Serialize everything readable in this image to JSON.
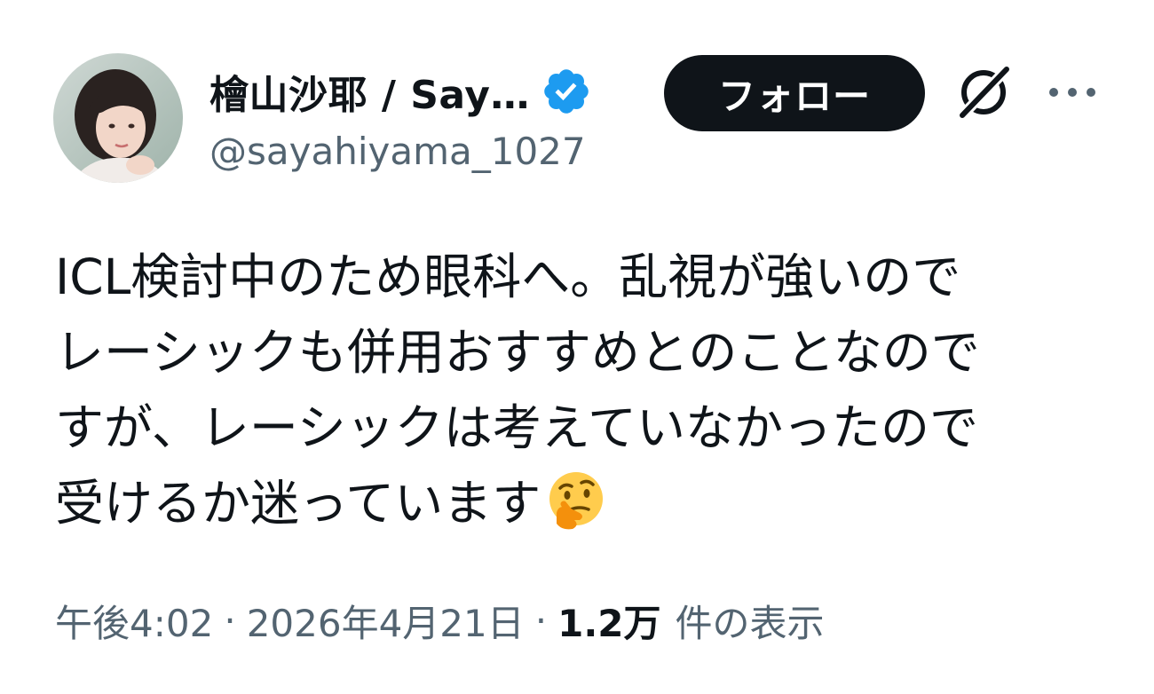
{
  "author": {
    "display_name": "檜山沙耶 / Say…",
    "handle": "@sayahiyama_1027",
    "verified": true
  },
  "header": {
    "follow_label": "フォロー",
    "grok_icon": "grok-icon",
    "more_icon": "more-horizontal-icon"
  },
  "tweet": {
    "lines": [
      "ICL検討中のため眼科へ。乱視が強いので",
      "レーシックも併用おすすめとのことなので",
      "すが、レーシックは考えていなかったので",
      "受けるか迷っています"
    ],
    "trailing_emoji": "thinking-face-emoji"
  },
  "meta": {
    "time": "午後4:02",
    "separator": "·",
    "date": "2026年4月21日",
    "views_count": "1.2万",
    "views_label": "件の表示"
  },
  "colors": {
    "text_primary": "#0f1419",
    "text_secondary": "#536471",
    "verified_blue": "#1d9bf0",
    "follow_bg": "#0f1419",
    "follow_text": "#ffffff"
  }
}
